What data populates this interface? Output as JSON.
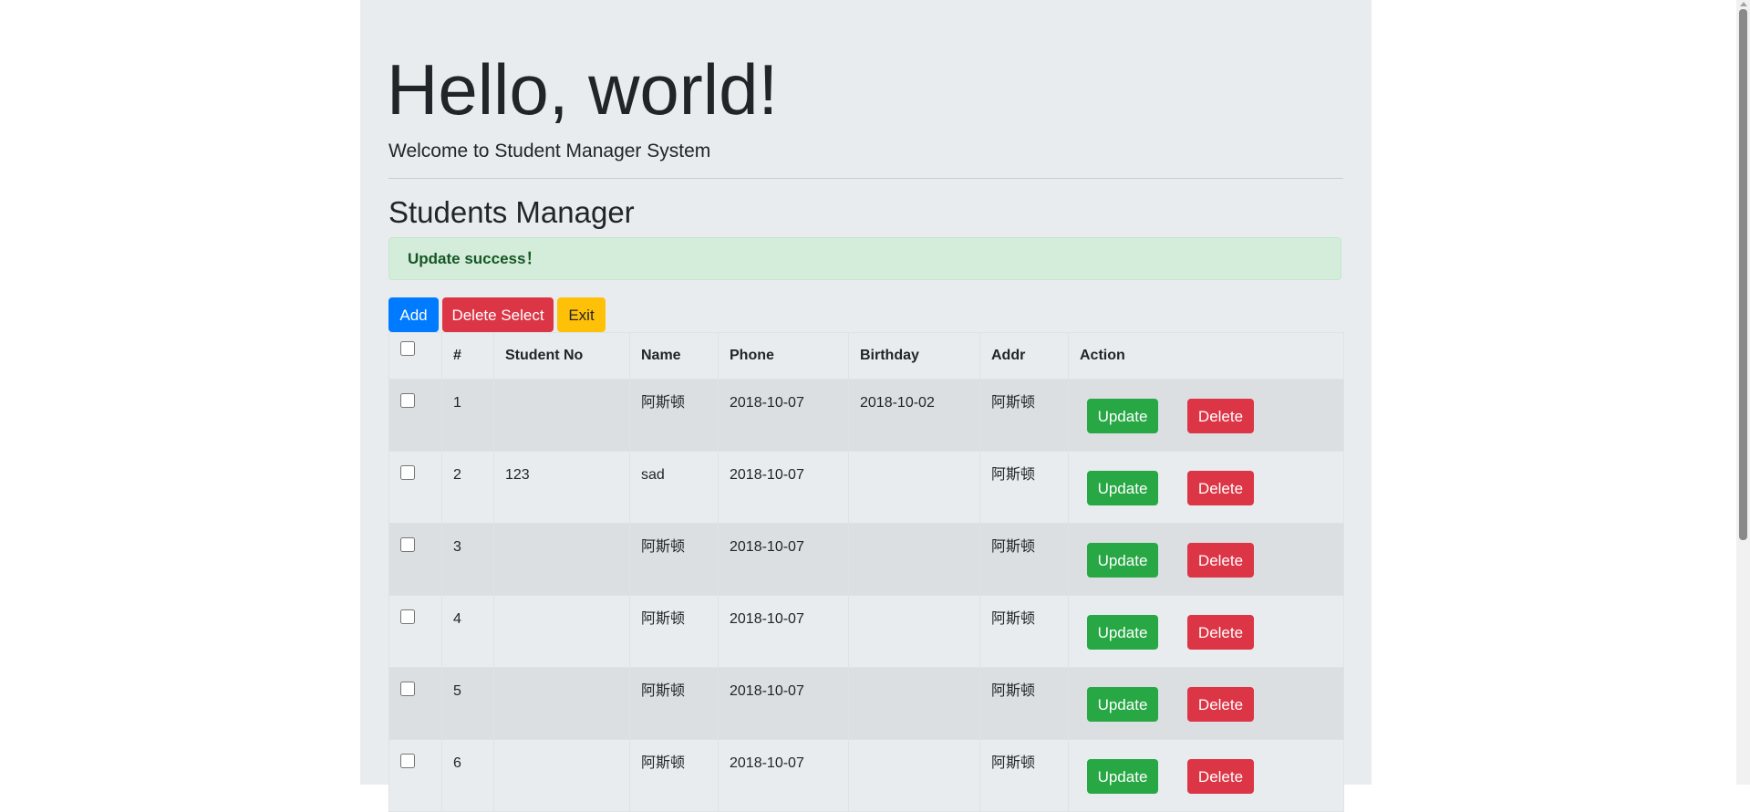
{
  "hero": {
    "title": "Hello, world!",
    "subtitle": "Welcome to Student Manager System"
  },
  "section": {
    "title": "Students Manager"
  },
  "alert": {
    "message": "Update success！"
  },
  "toolbar": {
    "add_label": "Add",
    "delete_select_label": "Delete Select",
    "exit_label": "Exit"
  },
  "table": {
    "headers": [
      "#",
      "Student No",
      "Name",
      "Phone",
      "Birthday",
      "Addr",
      "Action"
    ],
    "rows": [
      {
        "num": "1",
        "student_no": "",
        "name": "阿斯顿",
        "phone": "2018-10-07",
        "birthday": "2018-10-02",
        "addr": "阿斯顿"
      },
      {
        "num": "2",
        "student_no": "123",
        "name": "sad",
        "phone": "2018-10-07",
        "birthday": "",
        "addr": "阿斯顿"
      },
      {
        "num": "3",
        "student_no": "",
        "name": "阿斯顿",
        "phone": "2018-10-07",
        "birthday": "",
        "addr": "阿斯顿"
      },
      {
        "num": "4",
        "student_no": "",
        "name": "阿斯顿",
        "phone": "2018-10-07",
        "birthday": "",
        "addr": "阿斯顿"
      },
      {
        "num": "5",
        "student_no": "",
        "name": "阿斯顿",
        "phone": "2018-10-07",
        "birthday": "",
        "addr": "阿斯顿"
      },
      {
        "num": "6",
        "student_no": "",
        "name": "阿斯顿",
        "phone": "2018-10-07",
        "birthday": "",
        "addr": "阿斯顿"
      }
    ],
    "update_label": "Update",
    "delete_label": "Delete"
  },
  "colors": {
    "jumbotron_bg": "#e9ecef",
    "primary": "#007bff",
    "danger": "#dc3545",
    "warning": "#ffc107",
    "success": "#28a745",
    "alert_bg": "#d4edda",
    "alert_text": "#155724"
  }
}
